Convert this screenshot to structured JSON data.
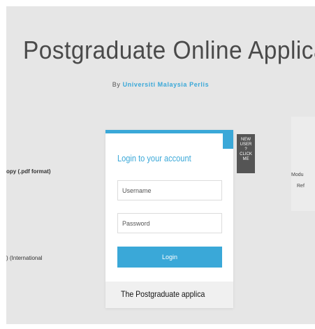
{
  "header": {
    "title": "Postgraduate Online Application",
    "by_prefix": "By",
    "university": "Universiti Malaysia Perlis"
  },
  "side": {
    "left_1": "opy (.pdf format)",
    "left_2": ") (International",
    "right_1": "Modu",
    "right_2": "Ref"
  },
  "login": {
    "heading": "Login to your account",
    "username_placeholder": "Username",
    "password_placeholder": "Password",
    "button": "Login",
    "footer": "The Postgraduate applica"
  },
  "new_user": {
    "lines": [
      "NEW",
      "USER",
      "?",
      "CLICK",
      "ME"
    ]
  },
  "colors": {
    "accent": "#3aa8d8",
    "background": "#e6e6e6",
    "new_user_bg": "#555555"
  }
}
